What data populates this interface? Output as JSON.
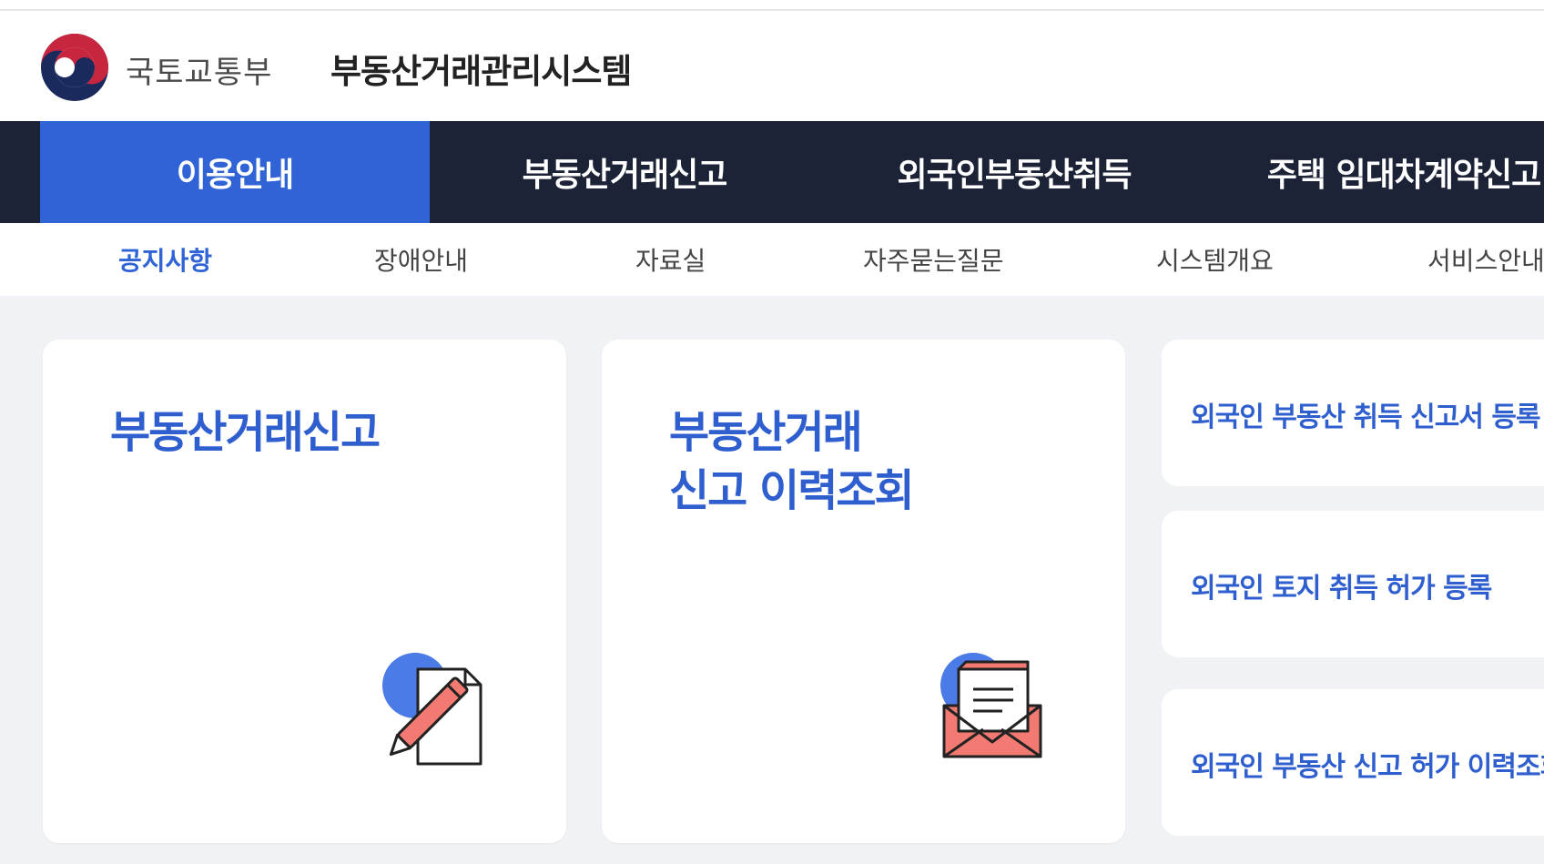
{
  "header": {
    "ministry": "국토교통부",
    "system_title": "부동산거래관리시스템"
  },
  "gnb": {
    "items": [
      {
        "label": "이용안내",
        "active": true
      },
      {
        "label": "부동산거래신고",
        "active": false
      },
      {
        "label": "외국인부동산취득",
        "active": false
      },
      {
        "label": "주택 임대차계약신고",
        "active": false
      }
    ]
  },
  "lnb": {
    "items": [
      {
        "label": "공지사항",
        "active": true
      },
      {
        "label": "장애안내",
        "active": false
      },
      {
        "label": "자료실",
        "active": false
      },
      {
        "label": "자주묻는질문",
        "active": false
      },
      {
        "label": "시스템개요",
        "active": false
      },
      {
        "label": "서비스안내",
        "active": false
      }
    ]
  },
  "main": {
    "cards": [
      {
        "title_lines": [
          "부동산거래신고"
        ],
        "icon": "pen-document-icon"
      },
      {
        "title_lines": [
          "부동산거래",
          "신고 이력조회"
        ],
        "icon": "envelope-letter-icon"
      }
    ],
    "side_links": [
      {
        "label": "외국인 부동산 취득 신고서 등록"
      },
      {
        "label": "외국인 토지 취득 허가 등록"
      },
      {
        "label": "외국인 부동산 신고 허가 이력조회"
      }
    ]
  },
  "colors": {
    "accent": "#2f63d6",
    "gnb_bg": "#1c2337",
    "card_title": "#2f5fcf",
    "page_bg": "#f0f2f5",
    "icon_salmon": "#f27a72",
    "icon_blue": "#4b7be6"
  }
}
